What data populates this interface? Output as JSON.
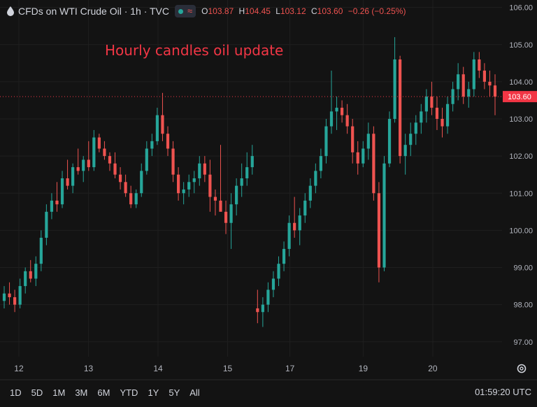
{
  "header": {
    "symbol": "CFDs on WTI Crude Oil · 1h · TVC",
    "ohlc": [
      {
        "k": "O",
        "v": "103.87"
      },
      {
        "k": "H",
        "v": "104.45"
      },
      {
        "k": "L",
        "v": "103.12"
      },
      {
        "k": "C",
        "v": "103.60"
      },
      {
        "k": "",
        "v": "−0.26 (−0.25%)"
      }
    ]
  },
  "annotation": "Hourly candles oil update",
  "last_price_label": "103.60",
  "time_ranges": [
    "1D",
    "5D",
    "1M",
    "3M",
    "6M",
    "YTD",
    "1Y",
    "5Y",
    "All"
  ],
  "clock": "01:59:20 UTC",
  "colors": {
    "up": "#26a69a",
    "down": "#ef5350",
    "background": "#131313",
    "grid": "#1f1f1f",
    "last_price": "#f23645"
  },
  "chart_data": {
    "type": "candlestick",
    "ylim": [
      96.6,
      106.2
    ],
    "yticks": [
      "97.00",
      "98.00",
      "99.00",
      "100.00",
      "101.00",
      "102.00",
      "103.00",
      "104.00",
      "105.00",
      "106.00"
    ],
    "xticks": [
      {
        "label": "12",
        "index": 4
      },
      {
        "label": "13",
        "index": 23
      },
      {
        "label": "14",
        "index": 42
      },
      {
        "label": "15",
        "index": 61
      },
      {
        "label": "17",
        "index": 78
      },
      {
        "label": "19",
        "index": 98
      },
      {
        "label": "20",
        "index": 117
      }
    ],
    "x_range": [
      0,
      134
    ],
    "last_price": 103.6,
    "candles": [
      [
        98.1,
        98.5,
        97.9,
        98.3
      ],
      [
        98.3,
        98.6,
        98.0,
        98.2
      ],
      [
        98.2,
        98.4,
        97.8,
        98.0
      ],
      [
        98.0,
        98.7,
        97.9,
        98.5
      ],
      [
        98.5,
        99.0,
        98.3,
        98.9
      ],
      [
        98.9,
        99.2,
        98.6,
        98.7
      ],
      [
        98.7,
        99.3,
        98.5,
        99.1
      ],
      [
        99.1,
        100.0,
        98.9,
        99.8
      ],
      [
        99.8,
        100.7,
        99.6,
        100.5
      ],
      [
        100.5,
        101.0,
        100.3,
        100.8
      ],
      [
        100.8,
        101.3,
        100.5,
        100.7
      ],
      [
        100.7,
        101.6,
        100.6,
        101.4
      ],
      [
        101.4,
        101.9,
        101.1,
        101.2
      ],
      [
        101.2,
        101.8,
        101.0,
        101.7
      ],
      [
        101.7,
        102.2,
        101.5,
        101.6
      ],
      [
        101.6,
        102.0,
        101.3,
        101.9
      ],
      [
        101.9,
        102.4,
        101.6,
        101.7
      ],
      [
        101.7,
        102.7,
        101.6,
        102.5
      ],
      [
        102.5,
        102.6,
        102.1,
        102.2
      ],
      [
        102.2,
        102.4,
        101.9,
        102.0
      ],
      [
        102.0,
        102.1,
        101.6,
        101.8
      ],
      [
        101.8,
        102.1,
        101.4,
        101.5
      ],
      [
        101.5,
        101.7,
        101.1,
        101.3
      ],
      [
        101.3,
        101.5,
        100.9,
        101.0
      ],
      [
        101.0,
        101.2,
        100.6,
        100.7
      ],
      [
        100.7,
        101.1,
        100.6,
        101.0
      ],
      [
        101.0,
        101.8,
        100.9,
        101.6
      ],
      [
        101.6,
        102.4,
        101.5,
        102.2
      ],
      [
        102.2,
        102.6,
        102.0,
        102.4
      ],
      [
        102.4,
        103.3,
        102.3,
        103.1
      ],
      [
        103.1,
        103.7,
        102.4,
        102.6
      ],
      [
        102.6,
        102.8,
        102.0,
        102.2
      ],
      [
        102.2,
        102.4,
        101.3,
        101.5
      ],
      [
        101.5,
        101.7,
        100.8,
        101.0
      ],
      [
        101.0,
        101.3,
        100.7,
        101.1
      ],
      [
        101.1,
        101.5,
        100.9,
        101.3
      ],
      [
        101.3,
        101.6,
        101.0,
        101.4
      ],
      [
        101.4,
        102.0,
        101.2,
        101.8
      ],
      [
        101.8,
        102.0,
        101.3,
        101.5
      ],
      [
        101.5,
        101.9,
        100.5,
        100.9
      ],
      [
        100.9,
        101.1,
        100.4,
        100.8
      ],
      [
        100.8,
        102.3,
        100.6,
        100.5
      ],
      [
        100.5,
        100.8,
        99.9,
        100.2
      ],
      [
        100.2,
        101.0,
        99.5,
        100.7
      ],
      [
        100.7,
        101.4,
        100.4,
        101.2
      ],
      [
        101.2,
        101.8,
        100.9,
        101.4
      ],
      [
        101.4,
        102.1,
        101.2,
        101.7
      ],
      [
        101.7,
        102.3,
        101.5,
        102.0
      ],
      [
        97.9,
        98.4,
        97.5,
        97.8
      ],
      [
        97.8,
        98.2,
        97.4,
        98.0
      ],
      [
        98.0,
        98.6,
        97.8,
        98.4
      ],
      [
        98.4,
        98.9,
        98.2,
        98.7
      ],
      [
        98.7,
        99.3,
        98.5,
        99.1
      ],
      [
        99.1,
        99.7,
        98.9,
        99.5
      ],
      [
        99.5,
        100.4,
        99.3,
        100.2
      ],
      [
        100.2,
        100.9,
        99.8,
        100.0
      ],
      [
        100.0,
        100.6,
        99.6,
        100.4
      ],
      [
        100.4,
        101.0,
        100.2,
        100.8
      ],
      [
        100.8,
        101.4,
        100.6,
        101.2
      ],
      [
        101.2,
        101.8,
        101.0,
        101.6
      ],
      [
        101.6,
        102.2,
        101.4,
        102.0
      ],
      [
        102.0,
        103.0,
        101.8,
        102.8
      ],
      [
        102.8,
        104.3,
        102.6,
        103.2
      ],
      [
        103.2,
        103.6,
        102.7,
        103.3
      ],
      [
        103.3,
        103.5,
        102.9,
        103.1
      ],
      [
        103.1,
        103.4,
        102.6,
        102.8
      ],
      [
        102.8,
        103.0,
        101.8,
        102.1
      ],
      [
        102.1,
        102.4,
        101.5,
        101.8
      ],
      [
        101.8,
        102.4,
        101.7,
        102.2
      ],
      [
        102.2,
        102.9,
        101.9,
        102.6
      ],
      [
        102.6,
        102.8,
        100.8,
        101.0
      ],
      [
        101.0,
        101.3,
        98.6,
        99.0
      ],
      [
        99.0,
        102.0,
        98.9,
        101.8
      ],
      [
        101.8,
        103.2,
        101.7,
        103.0
      ],
      [
        103.0,
        105.2,
        102.9,
        104.6
      ],
      [
        104.6,
        104.7,
        101.8,
        102.0
      ],
      [
        102.0,
        102.6,
        101.5,
        102.3
      ],
      [
        102.3,
        102.9,
        102.0,
        102.6
      ],
      [
        102.6,
        103.1,
        102.3,
        102.9
      ],
      [
        102.9,
        103.4,
        102.6,
        103.2
      ],
      [
        103.2,
        103.8,
        102.9,
        103.6
      ],
      [
        103.6,
        104.0,
        103.1,
        103.3
      ],
      [
        103.3,
        103.6,
        102.7,
        103.0
      ],
      [
        103.0,
        103.3,
        102.5,
        102.8
      ],
      [
        102.8,
        103.6,
        102.6,
        103.4
      ],
      [
        103.4,
        104.0,
        103.2,
        103.8
      ],
      [
        103.8,
        104.5,
        103.5,
        104.2
      ],
      [
        104.2,
        104.4,
        103.4,
        103.6
      ],
      [
        103.6,
        104.0,
        103.3,
        103.8
      ],
      [
        103.8,
        104.8,
        103.6,
        104.6
      ],
      [
        104.6,
        104.8,
        104.1,
        104.3
      ],
      [
        104.3,
        104.5,
        103.8,
        104.0
      ],
      [
        104.0,
        104.3,
        103.6,
        103.9
      ],
      [
        103.9,
        104.2,
        103.1,
        103.6
      ]
    ]
  }
}
